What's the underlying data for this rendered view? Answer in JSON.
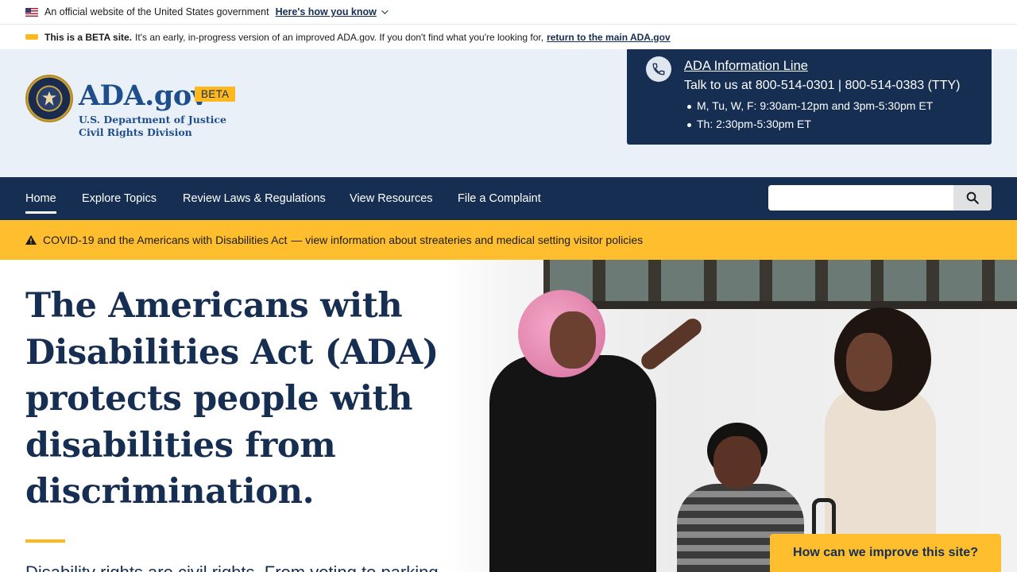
{
  "gov_banner": {
    "text": "An official website of the United States government",
    "link": "Here's how you know",
    "flag_icon": "us-flag-icon"
  },
  "beta_banner": {
    "strong": "This is a BETA site.",
    "text": "It's an early, in-progress version of an improved ADA.gov. If you don't find what you're looking for,",
    "link": "return to the main ADA.gov"
  },
  "header": {
    "logo_title": "ADA.gov",
    "badge": "BETA",
    "sub_line1": "U.S. Department of Justice",
    "sub_line2": "Civil Rights Division",
    "seal_icon": "doj-seal-icon"
  },
  "info_line": {
    "title": "ADA Information Line",
    "talk": "Talk to us at 800-514-0301 | 800-514-0383 (TTY)",
    "hours": [
      "M, Tu, W, F: 9:30am-12pm and 3pm-5:30pm ET",
      "Th: 2:30pm-5:30pm ET"
    ],
    "icon": "phone-icon"
  },
  "nav": {
    "items": [
      {
        "label": "Home"
      },
      {
        "label": "Explore Topics"
      },
      {
        "label": "Review Laws & Regulations"
      },
      {
        "label": "View Resources"
      },
      {
        "label": "File a Complaint"
      }
    ],
    "active": "Home",
    "search_placeholder": "",
    "search_icon": "search-icon"
  },
  "alert": {
    "text": "COVID-19 and the Americans with Disabilities Act",
    "link": "— view information about streateries and medical setting visitor policies",
    "icon": "warning-icon"
  },
  "hero": {
    "title": "The Americans with Disabilities Act (ADA) protects people with disabilities from discrimination.",
    "subtitle": "Disability rights are civil rights. From voting to parking"
  },
  "feedback": {
    "label": "How can we improve this site?"
  },
  "colors": {
    "navy": "#162e51",
    "gold": "#ffbe2e",
    "header_bg": "#eaf0f7"
  }
}
